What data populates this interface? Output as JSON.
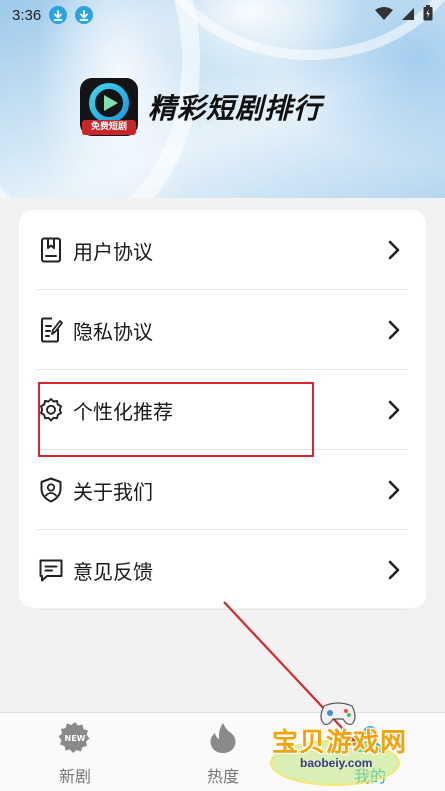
{
  "status_bar": {
    "time": "3:36",
    "icons": [
      "download-icon",
      "download-icon",
      "wifi-icon",
      "signal-icon",
      "battery-icon"
    ]
  },
  "header": {
    "app_name": "精彩短剧排行",
    "logo_ribbon": "免费短剧",
    "logo_icon": "play-logo-icon"
  },
  "menu": {
    "items": [
      {
        "label": "用户协议",
        "icon": "document-icon"
      },
      {
        "label": "隐私协议",
        "icon": "edit-document-icon"
      },
      {
        "label": "个性化推荐",
        "icon": "gear-icon"
      },
      {
        "label": "关于我们",
        "icon": "shield-user-icon"
      },
      {
        "label": "意见反馈",
        "icon": "message-icon"
      }
    ]
  },
  "highlighted_item": "个性化推荐",
  "bottom_nav": {
    "items": [
      {
        "label": "新剧",
        "icon": "new-badge-icon",
        "badge": "NEW"
      },
      {
        "label": "热度",
        "icon": "flame-icon"
      },
      {
        "label": "我的",
        "icon": "profile-icon",
        "active": true
      }
    ]
  },
  "watermark": {
    "text": "宝贝游戏网",
    "url": "baobeiy.com"
  },
  "colors": {
    "accent": "#26b0c8",
    "highlight_border": "#d9262c",
    "arrow": "#d9262c",
    "logo_ribbon": "#c9262a"
  }
}
